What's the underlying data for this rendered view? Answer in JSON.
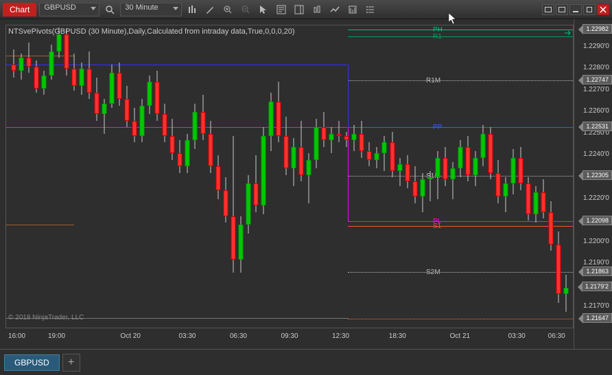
{
  "chart_data": {
    "type": "candlestick",
    "title": "NTSvePivots(GBPUSD (30 Minute),Daily,Calculated from intraday data,True,0,0,0,20)",
    "symbol": "GBPUSD",
    "interval": "30 Minute",
    "ylim": [
      1.216,
      1.23
    ],
    "y_ticks": [
      "1.2290'0",
      "1.2280'0",
      "1.2270'0",
      "1.2260'0",
      "1.2250'0",
      "1.2240'0",
      "1.2230'0",
      "1.2220'0",
      "1.2210'0",
      "1.2200'0",
      "1.2190'0",
      "1.2180'0",
      "1.2170'0"
    ],
    "x_ticks": [
      "16:00",
      "19:00",
      "Oct 20",
      "03:30",
      "06:30",
      "09:30",
      "12:30",
      "18:30",
      "Oct 21",
      "03:30",
      "06:30"
    ],
    "price_markers": [
      {
        "value": "1.22982",
        "y": 1.22982
      },
      {
        "value": "1.22747",
        "y": 1.22747
      },
      {
        "value": "1.22531",
        "y": 1.22531
      },
      {
        "value": "1.22305",
        "y": 1.22305
      },
      {
        "value": "1.22098",
        "y": 1.22098
      },
      {
        "value": "1.21863",
        "y": 1.21863
      },
      {
        "value": "1.2179'2",
        "y": 1.21792
      },
      {
        "value": "1.21647",
        "y": 1.21647
      }
    ],
    "pivots": [
      {
        "label": "PH",
        "color": "#00c080",
        "y": 1.22982,
        "x_label": 622
      },
      {
        "label": "R1",
        "color": "#00a060",
        "y": 1.2295,
        "x_label": 622
      },
      {
        "label": "R1M",
        "color": "#bbb",
        "y": 1.22747,
        "x_label": 612
      },
      {
        "label": "PP",
        "color": "#3060ff",
        "y": 1.22531,
        "x_label": 622
      },
      {
        "label": "S1M",
        "color": "#bbb",
        "y": 1.22305,
        "x_label": 612
      },
      {
        "label": "PL",
        "color": "#ff00ff",
        "y": 1.22098,
        "x_label": 622
      },
      {
        "label": "S1",
        "color": "#ff5030",
        "y": 1.22075,
        "x_label": 622
      },
      {
        "label": "S2M",
        "color": "#bbb",
        "y": 1.21863,
        "x_label": 612
      }
    ],
    "prev_day_lines": [
      {
        "color": "#3030ff",
        "y": 1.2282,
        "from": 0,
        "to": 0.6
      },
      {
        "color": "#ff00ff",
        "y": 1.2253,
        "from": 0,
        "to": 0.6
      },
      {
        "color": "#a06030",
        "y": 1.2286,
        "from": 0,
        "to": 0.12
      },
      {
        "color": "#a06030",
        "y": 1.2208,
        "from": 0,
        "to": 0.12
      }
    ],
    "candles": [
      {
        "t": 0,
        "o": 1.2282,
        "h": 1.2289,
        "l": 1.2276,
        "c": 1.2279
      },
      {
        "t": 1,
        "o": 1.2279,
        "h": 1.2287,
        "l": 1.2275,
        "c": 1.2285
      },
      {
        "t": 2,
        "o": 1.2285,
        "h": 1.2292,
        "l": 1.2278,
        "c": 1.2281
      },
      {
        "t": 3,
        "o": 1.2281,
        "h": 1.2284,
        "l": 1.2269,
        "c": 1.2271
      },
      {
        "t": 4,
        "o": 1.2271,
        "h": 1.2279,
        "l": 1.2268,
        "c": 1.2277
      },
      {
        "t": 5,
        "o": 1.2277,
        "h": 1.2291,
        "l": 1.2275,
        "c": 1.2288
      },
      {
        "t": 6,
        "o": 1.2288,
        "h": 1.2299,
        "l": 1.2285,
        "c": 1.2296
      },
      {
        "t": 7,
        "o": 1.2296,
        "h": 1.2298,
        "l": 1.2277,
        "c": 1.228
      },
      {
        "t": 8,
        "o": 1.228,
        "h": 1.2287,
        "l": 1.227,
        "c": 1.2272
      },
      {
        "t": 9,
        "o": 1.2272,
        "h": 1.2283,
        "l": 1.2268,
        "c": 1.228
      },
      {
        "t": 10,
        "o": 1.228,
        "h": 1.2288,
        "l": 1.2266,
        "c": 1.2269
      },
      {
        "t": 11,
        "o": 1.2269,
        "h": 1.2276,
        "l": 1.2256,
        "c": 1.2259
      },
      {
        "t": 12,
        "o": 1.2259,
        "h": 1.2266,
        "l": 1.225,
        "c": 1.2264
      },
      {
        "t": 13,
        "o": 1.2264,
        "h": 1.2282,
        "l": 1.2262,
        "c": 1.2278
      },
      {
        "t": 14,
        "o": 1.2278,
        "h": 1.2283,
        "l": 1.2263,
        "c": 1.2266
      },
      {
        "t": 15,
        "o": 1.2266,
        "h": 1.2272,
        "l": 1.2253,
        "c": 1.2256
      },
      {
        "t": 16,
        "o": 1.2256,
        "h": 1.2262,
        "l": 1.2246,
        "c": 1.2249
      },
      {
        "t": 17,
        "o": 1.2249,
        "h": 1.2266,
        "l": 1.2246,
        "c": 1.2263
      },
      {
        "t": 18,
        "o": 1.2263,
        "h": 1.2277,
        "l": 1.2259,
        "c": 1.2274
      },
      {
        "t": 19,
        "o": 1.2274,
        "h": 1.2279,
        "l": 1.2256,
        "c": 1.2259
      },
      {
        "t": 20,
        "o": 1.2259,
        "h": 1.2264,
        "l": 1.2246,
        "c": 1.2249
      },
      {
        "t": 21,
        "o": 1.2249,
        "h": 1.2257,
        "l": 1.2238,
        "c": 1.2241
      },
      {
        "t": 22,
        "o": 1.2241,
        "h": 1.2247,
        "l": 1.2232,
        "c": 1.2235
      },
      {
        "t": 23,
        "o": 1.2235,
        "h": 1.225,
        "l": 1.2232,
        "c": 1.2247
      },
      {
        "t": 24,
        "o": 1.2247,
        "h": 1.2264,
        "l": 1.2243,
        "c": 1.226
      },
      {
        "t": 25,
        "o": 1.226,
        "h": 1.2268,
        "l": 1.2247,
        "c": 1.225
      },
      {
        "t": 26,
        "o": 1.225,
        "h": 1.2256,
        "l": 1.2232,
        "c": 1.2235
      },
      {
        "t": 27,
        "o": 1.2235,
        "h": 1.224,
        "l": 1.222,
        "c": 1.2224
      },
      {
        "t": 28,
        "o": 1.2224,
        "h": 1.223,
        "l": 1.2209,
        "c": 1.2212
      },
      {
        "t": 29,
        "o": 1.2212,
        "h": 1.2249,
        "l": 1.2186,
        "c": 1.2192
      },
      {
        "t": 30,
        "o": 1.2192,
        "h": 1.2212,
        "l": 1.2186,
        "c": 1.2208
      },
      {
        "t": 31,
        "o": 1.2208,
        "h": 1.2231,
        "l": 1.2204,
        "c": 1.2227
      },
      {
        "t": 32,
        "o": 1.2227,
        "h": 1.224,
        "l": 1.2214,
        "c": 1.2217
      },
      {
        "t": 33,
        "o": 1.2217,
        "h": 1.2253,
        "l": 1.2213,
        "c": 1.2249
      },
      {
        "t": 34,
        "o": 1.2249,
        "h": 1.2269,
        "l": 1.2242,
        "c": 1.2265
      },
      {
        "t": 35,
        "o": 1.2265,
        "h": 1.2274,
        "l": 1.2246,
        "c": 1.2249
      },
      {
        "t": 36,
        "o": 1.2249,
        "h": 1.2258,
        "l": 1.2231,
        "c": 1.2234
      },
      {
        "t": 37,
        "o": 1.2234,
        "h": 1.2248,
        "l": 1.2226,
        "c": 1.2244
      },
      {
        "t": 38,
        "o": 1.2244,
        "h": 1.2256,
        "l": 1.2228,
        "c": 1.2231
      },
      {
        "t": 39,
        "o": 1.2231,
        "h": 1.2241,
        "l": 1.2218,
        "c": 1.2238
      },
      {
        "t": 40,
        "o": 1.2238,
        "h": 1.2257,
        "l": 1.2234,
        "c": 1.2253
      },
      {
        "t": 41,
        "o": 1.2253,
        "h": 1.226,
        "l": 1.2244,
        "c": 1.2247
      },
      {
        "t": 42,
        "o": 1.2247,
        "h": 1.2253,
        "l": 1.2241,
        "c": 1.225
      },
      {
        "t": 43,
        "o": 1.225,
        "h": 1.2256,
        "l": 1.2246,
        "c": 1.2249
      },
      {
        "t": 44,
        "o": 1.2249,
        "h": 1.2251,
        "l": 1.2244,
        "c": 1.2247
      },
      {
        "t": 45,
        "o": 1.2247,
        "h": 1.2254,
        "l": 1.2242,
        "c": 1.225
      },
      {
        "t": 46,
        "o": 1.225,
        "h": 1.2256,
        "l": 1.2239,
        "c": 1.2242
      },
      {
        "t": 47,
        "o": 1.2242,
        "h": 1.2246,
        "l": 1.2235,
        "c": 1.2238
      },
      {
        "t": 48,
        "o": 1.2238,
        "h": 1.2244,
        "l": 1.2234,
        "c": 1.2241
      },
      {
        "t": 49,
        "o": 1.2241,
        "h": 1.2249,
        "l": 1.2233,
        "c": 1.2246
      },
      {
        "t": 50,
        "o": 1.2246,
        "h": 1.2251,
        "l": 1.223,
        "c": 1.2233
      },
      {
        "t": 51,
        "o": 1.2233,
        "h": 1.2239,
        "l": 1.2226,
        "c": 1.2236
      },
      {
        "t": 52,
        "o": 1.2236,
        "h": 1.224,
        "l": 1.2225,
        "c": 1.2228
      },
      {
        "t": 53,
        "o": 1.2228,
        "h": 1.2235,
        "l": 1.2218,
        "c": 1.2221
      },
      {
        "t": 54,
        "o": 1.2221,
        "h": 1.2232,
        "l": 1.2214,
        "c": 1.2229
      },
      {
        "t": 55,
        "o": 1.2229,
        "h": 1.2233,
        "l": 1.2219,
        "c": 1.223
      },
      {
        "t": 56,
        "o": 1.223,
        "h": 1.2242,
        "l": 1.222,
        "c": 1.2239
      },
      {
        "t": 57,
        "o": 1.2239,
        "h": 1.2244,
        "l": 1.2226,
        "c": 1.2229
      },
      {
        "t": 58,
        "o": 1.2229,
        "h": 1.2237,
        "l": 1.222,
        "c": 1.2234
      },
      {
        "t": 59,
        "o": 1.2234,
        "h": 1.2247,
        "l": 1.223,
        "c": 1.2244
      },
      {
        "t": 60,
        "o": 1.2244,
        "h": 1.2249,
        "l": 1.2228,
        "c": 1.2231
      },
      {
        "t": 61,
        "o": 1.2231,
        "h": 1.2242,
        "l": 1.2226,
        "c": 1.2239
      },
      {
        "t": 62,
        "o": 1.2239,
        "h": 1.2254,
        "l": 1.2235,
        "c": 1.225
      },
      {
        "t": 63,
        "o": 1.225,
        "h": 1.2253,
        "l": 1.2229,
        "c": 1.2232
      },
      {
        "t": 64,
        "o": 1.2232,
        "h": 1.2238,
        "l": 1.2218,
        "c": 1.2221
      },
      {
        "t": 65,
        "o": 1.2221,
        "h": 1.223,
        "l": 1.2214,
        "c": 1.2227
      },
      {
        "t": 66,
        "o": 1.2227,
        "h": 1.2243,
        "l": 1.2222,
        "c": 1.2239
      },
      {
        "t": 67,
        "o": 1.2239,
        "h": 1.2244,
        "l": 1.2224,
        "c": 1.2227
      },
      {
        "t": 68,
        "o": 1.2227,
        "h": 1.223,
        "l": 1.221,
        "c": 1.2213
      },
      {
        "t": 69,
        "o": 1.2213,
        "h": 1.2226,
        "l": 1.2209,
        "c": 1.2223
      },
      {
        "t": 70,
        "o": 1.2223,
        "h": 1.2229,
        "l": 1.2211,
        "c": 1.2214
      },
      {
        "t": 71,
        "o": 1.2214,
        "h": 1.2219,
        "l": 1.2196,
        "c": 1.2199
      },
      {
        "t": 72,
        "o": 1.2199,
        "h": 1.2205,
        "l": 1.2172,
        "c": 1.2176
      },
      {
        "t": 73,
        "o": 1.2176,
        "h": 1.2185,
        "l": 1.2168,
        "c": 1.2179
      }
    ]
  },
  "toolbar": {
    "chart_label": "Chart",
    "symbol": "GBPUSD",
    "interval": "30 Minute"
  },
  "tabs": {
    "active": "GBPUSD",
    "add": "+"
  },
  "copyright": "© 2018 NinjaTrader, LLC",
  "indicator_label": "NTSvePivots(GBPUSD (30 Minute),Daily,Calculated from intraday data,True,0,0,0,20)"
}
